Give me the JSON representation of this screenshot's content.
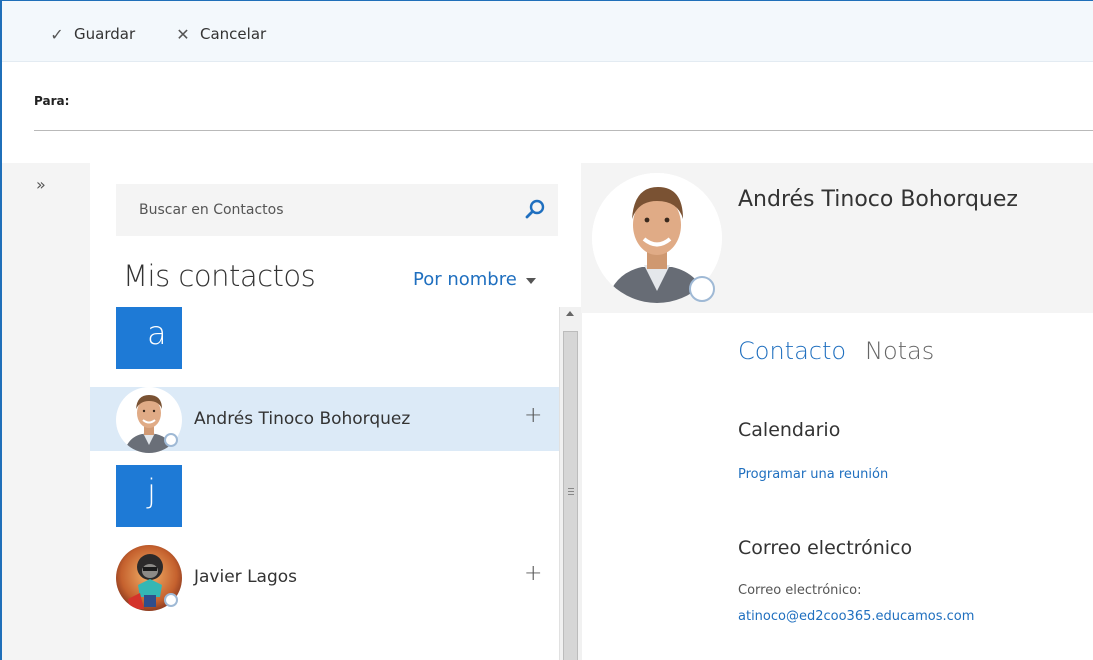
{
  "toolbar": {
    "save_label": "Guardar",
    "cancel_label": "Cancelar"
  },
  "compose": {
    "to_label": "Para:"
  },
  "search": {
    "placeholder": "Buscar en Contactos"
  },
  "contact_list": {
    "title": "Mis contactos",
    "sort_label": "Por nombre",
    "groups": [
      {
        "letter": "a",
        "contacts": [
          {
            "name": "Andrés Tinoco Bohorquez",
            "selected": true
          }
        ]
      },
      {
        "letter": "j",
        "contacts": [
          {
            "name": "Javier Lagos",
            "selected": false
          }
        ]
      }
    ]
  },
  "details": {
    "name": "Andrés Tinoco Bohorquez",
    "tabs": [
      {
        "label": "Contacto",
        "active": true
      },
      {
        "label": "Notas",
        "active": false
      }
    ],
    "calendar": {
      "title": "Calendario",
      "action": "Programar una reunión"
    },
    "email": {
      "title": "Correo electrónico",
      "field_label": "Correo electrónico:",
      "value": "atinoco@ed2coo365.educamos.com"
    }
  },
  "colors": {
    "accent": "#1f6fbf",
    "letter_tile": "#1e7ad6",
    "selected_row": "#dceaf7",
    "toolbar_bg": "#f3f8fc",
    "pane_bg": "#f4f4f4"
  },
  "icons": {
    "save": "checkmark-icon",
    "cancel": "x-icon",
    "expand": "double-chevron-right-icon",
    "search": "search-icon",
    "sort": "caret-down-icon",
    "add": "plus-icon",
    "presence": "presence-circle-icon"
  }
}
